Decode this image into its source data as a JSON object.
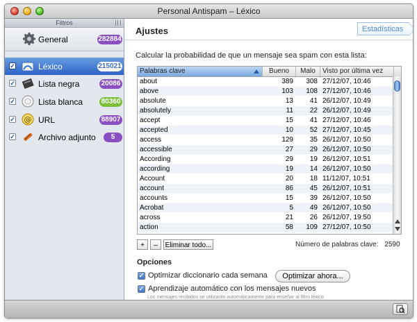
{
  "window": {
    "title": "Personal Antispam – Léxico"
  },
  "sidebar": {
    "header": "Filtros",
    "general": {
      "label": "General",
      "count": "282884",
      "badge_color": "#8a50c2"
    },
    "items": [
      {
        "label": "Léxico",
        "count": "215021",
        "checked": true,
        "selected": true,
        "icon": "lexicon-icon",
        "badge_color": "#ffffff"
      },
      {
        "label": "Lista negra",
        "count": "20086",
        "checked": true,
        "selected": false,
        "icon": "blacklist-icon",
        "badge_color": "#8a50c2"
      },
      {
        "label": "Lista blanca",
        "count": "80360",
        "checked": true,
        "selected": false,
        "icon": "whitelist-icon",
        "badge_color": "#7dbf3a"
      },
      {
        "label": "URL",
        "count": "88907",
        "checked": true,
        "selected": false,
        "icon": "url-icon",
        "badge_color": "#8a50c2"
      },
      {
        "label": "Archivo adjunto",
        "count": "5",
        "checked": true,
        "selected": false,
        "icon": "attachment-icon",
        "badge_color": "#8a50c2"
      }
    ]
  },
  "main": {
    "heading": "Ajustes",
    "stats_button": "Estadísticas",
    "prompt": "Calcular la probabilidad de que un mensaje sea spam con esta lista:",
    "table": {
      "columns": [
        "Palabras clave",
        "Bueno",
        "Malo",
        "Visto por última vez"
      ],
      "rows": [
        [
          "about",
          "389",
          "308",
          "27/12/07, 10:46"
        ],
        [
          "above",
          "103",
          "108",
          "27/12/07, 10:46"
        ],
        [
          "absolute",
          "13",
          "41",
          "26/12/07, 10:49"
        ],
        [
          "absolutely",
          "11",
          "22",
          "26/12/07, 10:49"
        ],
        [
          "accept",
          "15",
          "41",
          "27/12/07, 10:46"
        ],
        [
          "accepted",
          "10",
          "52",
          "27/12/07, 10:45"
        ],
        [
          "access",
          "129",
          "35",
          "26/12/07, 10:50"
        ],
        [
          "accessible",
          "27",
          "29",
          "26/12/07, 10:50"
        ],
        [
          "According",
          "29",
          "19",
          "26/12/07, 10:51"
        ],
        [
          "according",
          "19",
          "14",
          "26/12/07, 10:50"
        ],
        [
          "Account",
          "20",
          "18",
          "11/12/07, 10:51"
        ],
        [
          "account",
          "86",
          "45",
          "26/12/07, 10:51"
        ],
        [
          "accounts",
          "15",
          "39",
          "26/12/07, 10:50"
        ],
        [
          "Acrobat",
          "5",
          "49",
          "26/12/07, 10:50"
        ],
        [
          "across",
          "21",
          "26",
          "26/12/07, 19:50"
        ],
        [
          "action",
          "58",
          "109",
          "27/12/07, 10:50"
        ]
      ]
    },
    "add_label": "+",
    "remove_label": "–",
    "clear_label": "Eliminar todo...",
    "count_label": "Número de palabras clave:",
    "count_value": "2590",
    "options": {
      "heading": "Opciones",
      "optimize_weekly": "Optimizar diccionario cada semana",
      "optimize_now": "Optimizar ahora...",
      "auto_learn": "Aprendizaje automático con los mensajes nuevos",
      "hint": "Los mensajes recibidos se utilizarán automáticamente para enseñar al filtro léxico."
    }
  }
}
